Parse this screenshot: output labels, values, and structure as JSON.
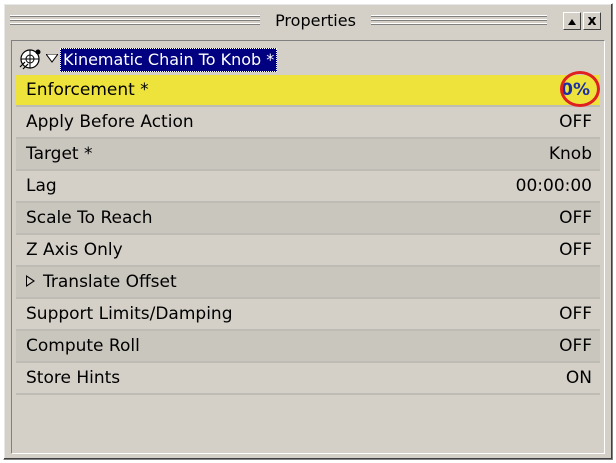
{
  "window": {
    "title": "Properties",
    "buttons": {
      "up_icon": "caret-up-icon",
      "close_label": "x"
    }
  },
  "header": {
    "icon": "kinematic-chain-icon",
    "chain_name": "Kinematic Chain To Knob *"
  },
  "properties": [
    {
      "label": "Enforcement *",
      "value": "0%"
    },
    {
      "label": "Apply Before Action",
      "value": "OFF"
    },
    {
      "label": "Target *",
      "value": "Knob"
    },
    {
      "label": "Lag",
      "value": "00:00:00"
    },
    {
      "label": "Scale To Reach",
      "value": "OFF"
    },
    {
      "label": "Z Axis Only",
      "value": "OFF"
    },
    {
      "label": "Translate Offset",
      "value": ""
    },
    {
      "label": "Support Limits/Damping",
      "value": "OFF"
    },
    {
      "label": "Compute Roll",
      "value": "OFF"
    },
    {
      "label": "Store Hints",
      "value": "ON"
    }
  ],
  "colors": {
    "highlight": "#eee33b",
    "selection": "#000080",
    "annotation_circle": "#e02020",
    "percent_value": "#1a2ea8"
  }
}
